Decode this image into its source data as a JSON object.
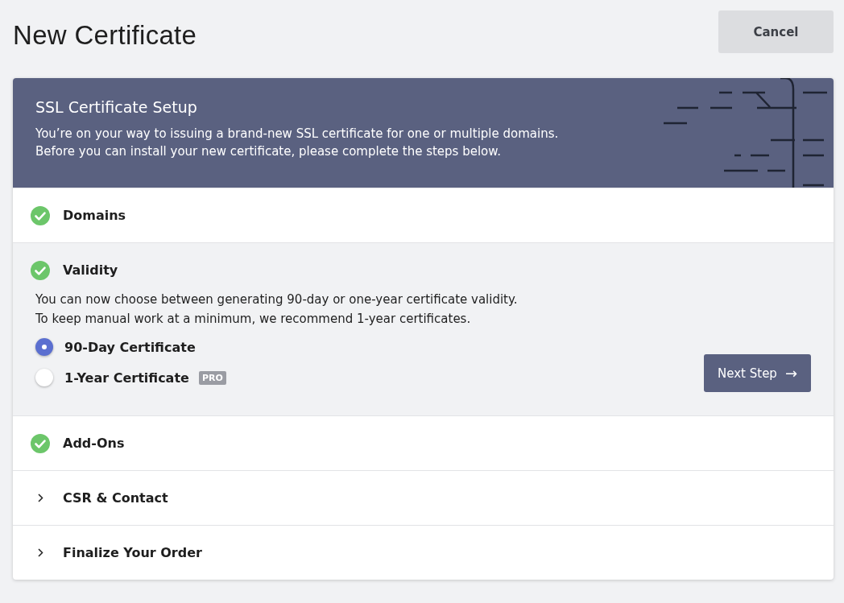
{
  "page": {
    "title": "New Certificate",
    "cancel_button": "Cancel"
  },
  "header": {
    "title": "SSL Certificate Setup",
    "lines": [
      "You’re on your way to issuing a brand-new SSL certificate for one or multiple domains.",
      "Before you can install your new certificate, please complete the steps below."
    ]
  },
  "steps": [
    {
      "label": "Domains",
      "kind": "done",
      "expanded": false
    },
    {
      "label": "Validity",
      "kind": "done",
      "expanded": true,
      "description": [
        "You can now choose between generating 90-day or one-year certificate validity.",
        "To keep manual work at a minimum, we recommend 1-year certificates."
      ],
      "options": [
        {
          "label": "90-Day Certificate",
          "selected": true
        },
        {
          "label": "1-Year Certificate",
          "selected": false,
          "badge": "PRO"
        }
      ],
      "next_button": "Next Step",
      "next_icon": "→"
    },
    {
      "label": "Add-Ons",
      "kind": "done",
      "expanded": false
    },
    {
      "label": "CSR & Contact",
      "kind": "pending",
      "expanded": false
    },
    {
      "label": "Finalize Your Order",
      "kind": "pending",
      "expanded": false
    }
  ]
}
